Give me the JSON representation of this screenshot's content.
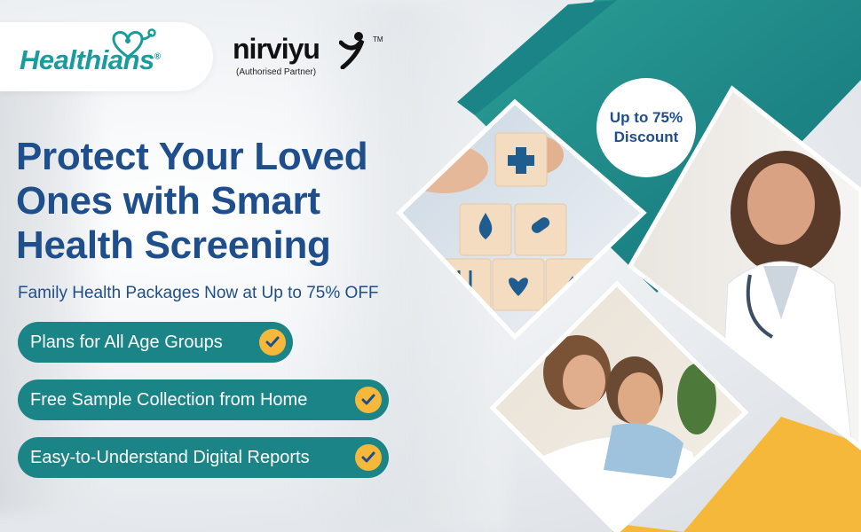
{
  "brand": {
    "name": "Healthians",
    "registered": "®"
  },
  "partner": {
    "name": "nirviyu",
    "tm": "TM",
    "subtitle": "(Authorised Partner)"
  },
  "headline": {
    "line1": "Protect Your Loved",
    "line2": "Ones with Smart",
    "line3": "Health Screening"
  },
  "subheadline": "Family Health Packages Now at Up to 75% OFF",
  "features": [
    {
      "label": "Plans for All Age Groups"
    },
    {
      "label": "Free Sample Collection from Home"
    },
    {
      "label": "Easy-to-Understand Digital Reports"
    }
  ],
  "badge": {
    "line1": "Up to 75%",
    "line2": "Discount"
  },
  "colors": {
    "teal": "#1a8487",
    "navy": "#1f4e8c",
    "yellow": "#f6b83a"
  }
}
